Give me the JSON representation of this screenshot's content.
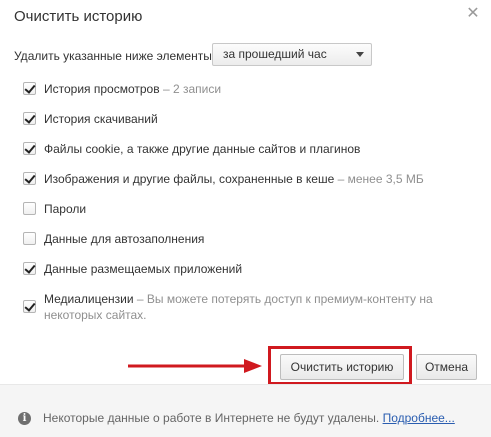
{
  "dialog": {
    "title": "Очистить историю",
    "close_glyph": "✕"
  },
  "period": {
    "label": "Удалить указанные ниже элементы",
    "selected": "за прошедший час"
  },
  "options": [
    {
      "label": "История просмотров",
      "note": "– 2 записи",
      "checked": true
    },
    {
      "label": "История скачиваний",
      "note": "",
      "checked": true
    },
    {
      "label": "Файлы cookie, а также другие данные сайтов и плагинов",
      "note": "",
      "checked": true
    },
    {
      "label": "Изображения и другие файлы, сохраненные в кеше",
      "note": "– менее 3,5 МБ",
      "checked": true
    },
    {
      "label": "Пароли",
      "note": "",
      "checked": false
    },
    {
      "label": "Данные для автозаполнения",
      "note": "",
      "checked": false
    },
    {
      "label": "Данные размещаемых приложений",
      "note": "",
      "checked": true
    },
    {
      "label": "Медиалицензии",
      "note": "– Вы можете потерять доступ к премиум-контенту на",
      "note2": "некоторых сайтах.",
      "checked": true
    }
  ],
  "buttons": {
    "clear_label": "Очистить историю",
    "cancel_label": "Отмена"
  },
  "footer": {
    "text": "Некоторые данные о работе в Интернете не будут удалены.",
    "link": "Подробнее..."
  },
  "colors": {
    "highlight": "#d0191f",
    "link": "#2a5db0"
  },
  "icons": {
    "info": "info-icon",
    "close": "close-icon",
    "caret": "chevron-down-icon",
    "arrow": "arrow-right-icon"
  }
}
